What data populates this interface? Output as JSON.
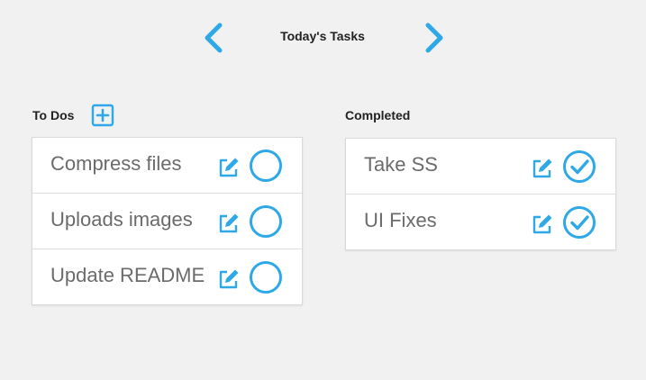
{
  "header": {
    "title": "Today's Tasks",
    "prev_icon": "chevron-left-icon",
    "next_icon": "chevron-right-icon"
  },
  "todos": {
    "heading": "To Dos",
    "add_icon": "plus-square-icon",
    "items": [
      {
        "label": "Compress files",
        "done": false
      },
      {
        "label": "Uploads images",
        "done": false
      },
      {
        "label": "Update README",
        "done": false
      }
    ]
  },
  "completed": {
    "heading": "Completed",
    "items": [
      {
        "label": "Take SS",
        "done": true
      },
      {
        "label": "UI Fixes",
        "done": true
      }
    ]
  },
  "colors": {
    "accent": "#2ea8e6",
    "background": "#f1f1f1",
    "card": "#ffffff",
    "text": "#6b6b6b",
    "heading": "#222222"
  }
}
